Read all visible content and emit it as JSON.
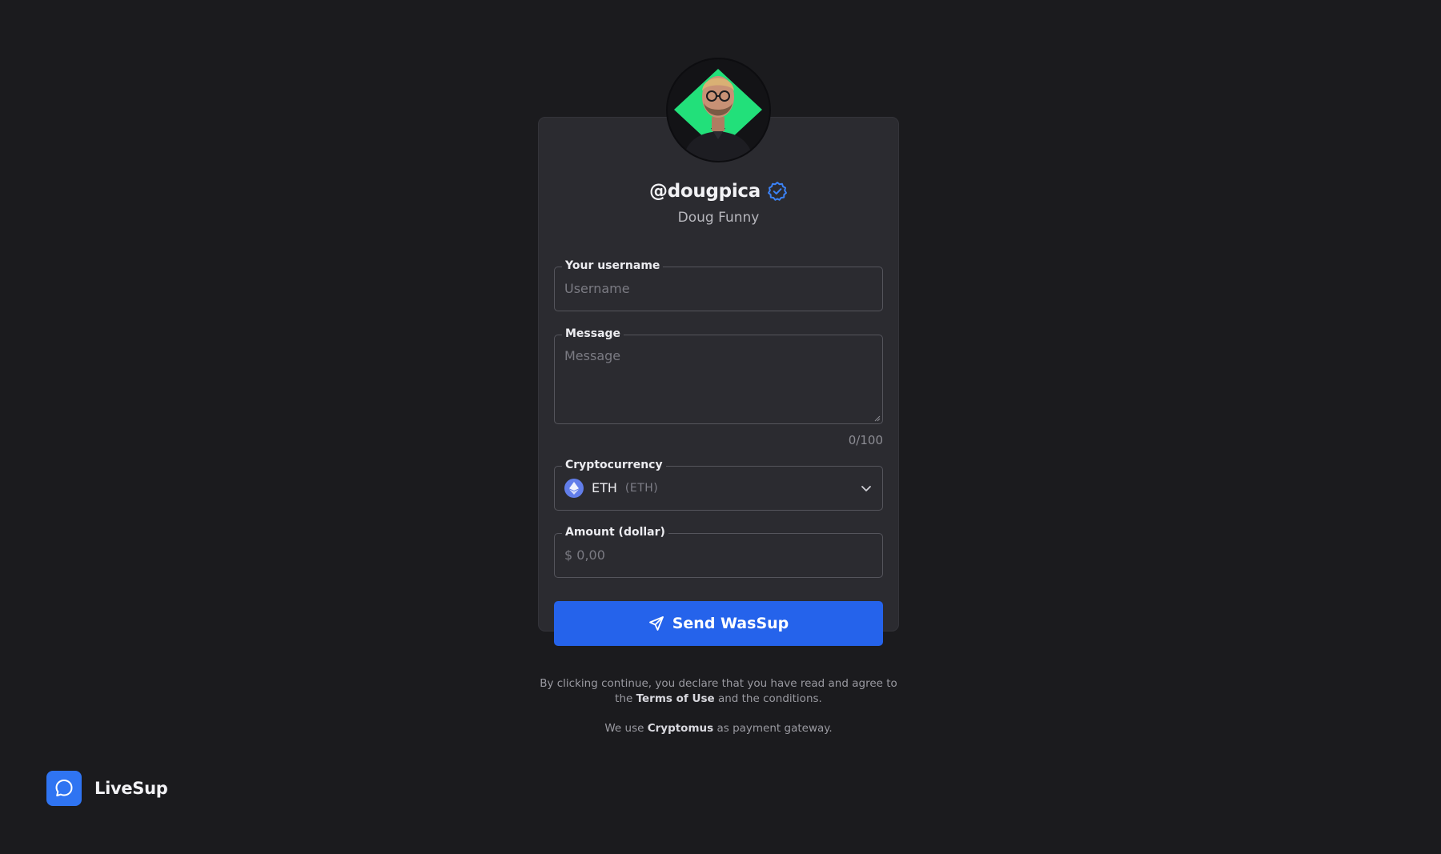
{
  "profile": {
    "handle": "@dougpica",
    "display_name": "Doug Funny",
    "verified": true,
    "avatar_icon": "avatar-photo",
    "verified_icon": "verified-badge-icon"
  },
  "form": {
    "username": {
      "label": "Your username",
      "placeholder": "Username",
      "value": ""
    },
    "message": {
      "label": "Message",
      "placeholder": "Message",
      "value": "",
      "counter": "0/100"
    },
    "cryptocurrency": {
      "label": "Cryptocurrency",
      "selected_name": "ETH",
      "selected_code": "(ETH)",
      "icon": "ethereum-icon"
    },
    "amount": {
      "label": "Amount (dollar)",
      "placeholder": "$ 0,00",
      "value": ""
    },
    "submit": {
      "label": "Send WasSup",
      "icon": "send-icon"
    }
  },
  "legal": {
    "prefix": "By clicking continue, you declare that you have read and agree to the ",
    "terms_link": "Terms of Use",
    "suffix": " and the conditions."
  },
  "gateway": {
    "prefix": "We use ",
    "name": "Cryptomus",
    "suffix": " as payment gateway."
  },
  "brand": {
    "name": "LiveSup",
    "icon": "chat-bubble-icon"
  },
  "colors": {
    "background": "#1b1b1e",
    "card": "#2b2b30",
    "accent": "#2563eb",
    "brand": "#2f74f2",
    "verified": "#3b82f6",
    "eth": "#627eea",
    "avatar_accent": "#22e07a"
  }
}
